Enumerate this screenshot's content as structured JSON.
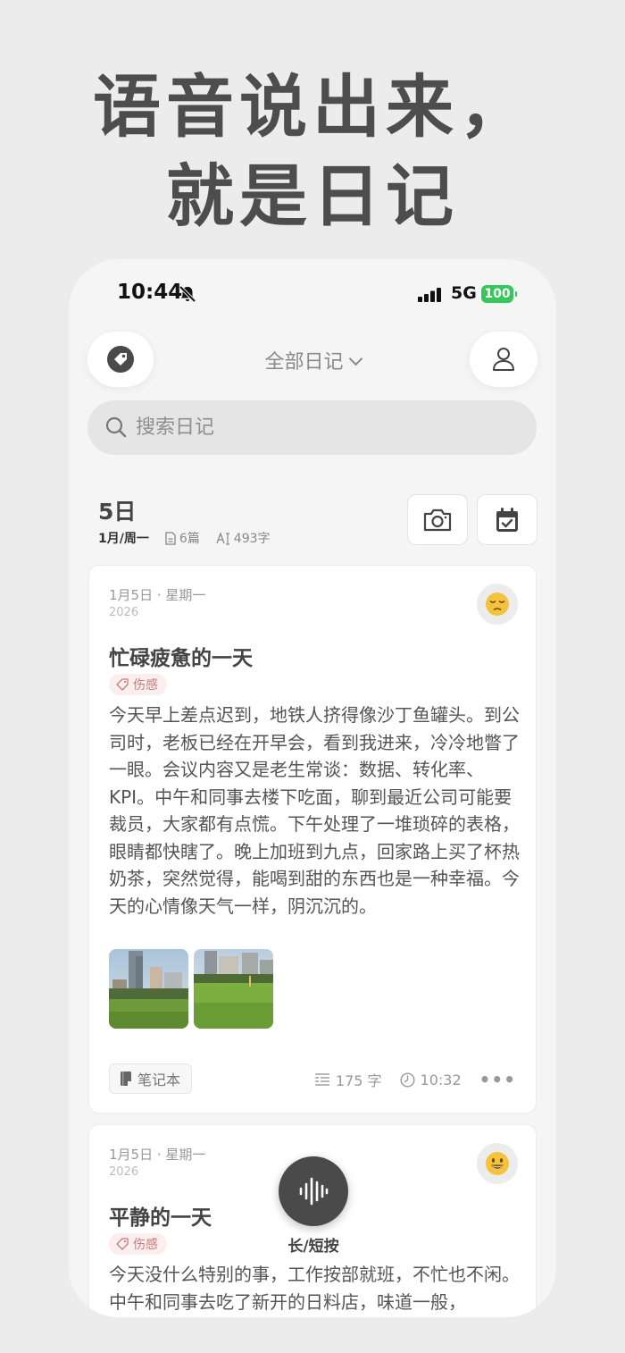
{
  "headline": {
    "line1": "语音说出来，",
    "line2": "就是日记"
  },
  "status_bar": {
    "time": "10:44",
    "network": "5G",
    "battery": "100"
  },
  "nav": {
    "title": "全部日记"
  },
  "search": {
    "placeholder": "搜索日记"
  },
  "day_header": {
    "day": "5日",
    "month_week": "1月/周一",
    "entries": "6篇",
    "words": "493字"
  },
  "entries": [
    {
      "date": "1月5日 · 星期一",
      "year": "2026",
      "mood": "pensive-face",
      "title": "忙碌疲惫的一天",
      "tag": "伤感",
      "body": "今天早上差点迟到，地铁人挤得像沙丁鱼罐头。到公司时，老板已经在开早会，看到我进来，冷冷地瞥了一眼。会议内容又是老生常谈：数据、转化率、KPI。中午和同事去楼下吃面，聊到最近公司可能要裁员，大家都有点慌。下午处理了一堆琐碎的表格，眼睛都快瞎了。晚上加班到九点，回家路上买了杯热奶茶，突然觉得，能喝到甜的东西也是一种幸福。今天的心情像天气一样，阴沉沉的。",
      "notebook": "笔记本",
      "word_count": "175 字",
      "time": "10:32"
    },
    {
      "date": "1月5日 · 星期一",
      "year": "2026",
      "mood": "smiley-face",
      "title": "平静的一天",
      "tag": "伤感",
      "body": "今天没什么特别的事，工作按部就班，不忙也不闲。中午和同事去吃了新开的日料店，味道一般，"
    }
  ],
  "record_button": {
    "label": "长/短按"
  },
  "colors": {
    "accent_dark": "#4a4a4a",
    "battery_green": "#34c759",
    "tag_red": "#c97b7b",
    "phone_bg": "#f5f5f5",
    "page_bg": "#ececec"
  }
}
